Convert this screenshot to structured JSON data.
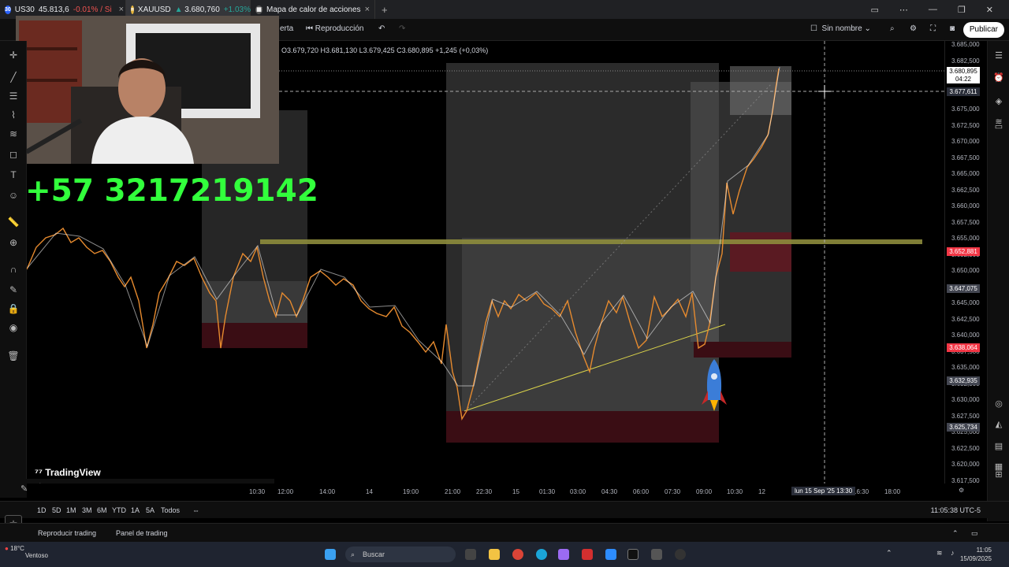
{
  "browser": {
    "tabs": [
      {
        "icon": "US30",
        "symbol": "US30",
        "price": "45.813,6",
        "change": "-0.01% / Si",
        "active": false
      },
      {
        "icon": "XAU",
        "symbol": "XAUUSD",
        "price": "3.680,760",
        "change": "+1.03%",
        "active": true
      },
      {
        "icon": "map",
        "symbol": "Mapa de calor de acciones",
        "price": "",
        "change": "",
        "active": false
      }
    ],
    "new_tab_label": "+"
  },
  "toolbar": {
    "alert_label": "erta",
    "replay_label": "Reproducción",
    "layout_name": "Sin nombre",
    "publish_label": "Publicar"
  },
  "ohlc": "O3.679,720  H3.681,130  L3.679,425  C3.680,895  +1,245 (+0,03%)",
  "overlay": {
    "phone": "+57 3217219142",
    "watermark": "TradingView"
  },
  "price_axis": {
    "ticks": [
      "3.685,000",
      "3.682,500",
      "3.680,000",
      "3.677,500",
      "3.675,000",
      "3.672,500",
      "3.670,000",
      "3.667,500",
      "3.665,000",
      "3.662,500",
      "3.660,000",
      "3.657,500",
      "3.655,000",
      "3.652,500",
      "3.650,000",
      "3.647,500",
      "3.645,000",
      "3.642,500",
      "3.640,000",
      "3.637,500",
      "3.635,000",
      "3.632,500",
      "3.630,000",
      "3.627,500",
      "3.625,000",
      "3.622,500",
      "3.620,000",
      "3.617,500"
    ],
    "labels": {
      "last_price": "3.680,895",
      "countdown": "04:22",
      "crosshair": "3.677,611",
      "red_1": "3.652,881",
      "gray_1": "3.647,075",
      "red_2": "3.638,064",
      "gray_2": "3.632,935",
      "gray_3": "3.625,734"
    },
    "colors": {
      "red": "#f23645",
      "gray": "#434651",
      "crosshair": "#2a2e39"
    }
  },
  "time_axis": {
    "ticks": [
      "10:30",
      "12:00",
      "14:00",
      "14",
      "19:00",
      "21:00",
      "22:30",
      "15",
      "01:30",
      "03:00",
      "04:30",
      "06:00",
      "07:30",
      "09:00",
      "10:30",
      "12",
      "13:30",
      "15:00",
      "16:30",
      "18:00"
    ],
    "crosshair_label": "lun 15 Sep '25  13:30"
  },
  "timeframes": {
    "items": [
      "1D",
      "5D",
      "1M",
      "3M",
      "6M",
      "YTD",
      "1A",
      "5A",
      "Todos"
    ],
    "clock": "11:05:38 UTC-5"
  },
  "panels": {
    "replay_trading": "Reproducir trading",
    "trading_panel": "Panel de trading"
  },
  "taskbar": {
    "weather_temp": "18°C",
    "weather_desc": "Ventoso",
    "search_placeholder": "Buscar",
    "time": "11:05",
    "date": "15/09/2025"
  }
}
